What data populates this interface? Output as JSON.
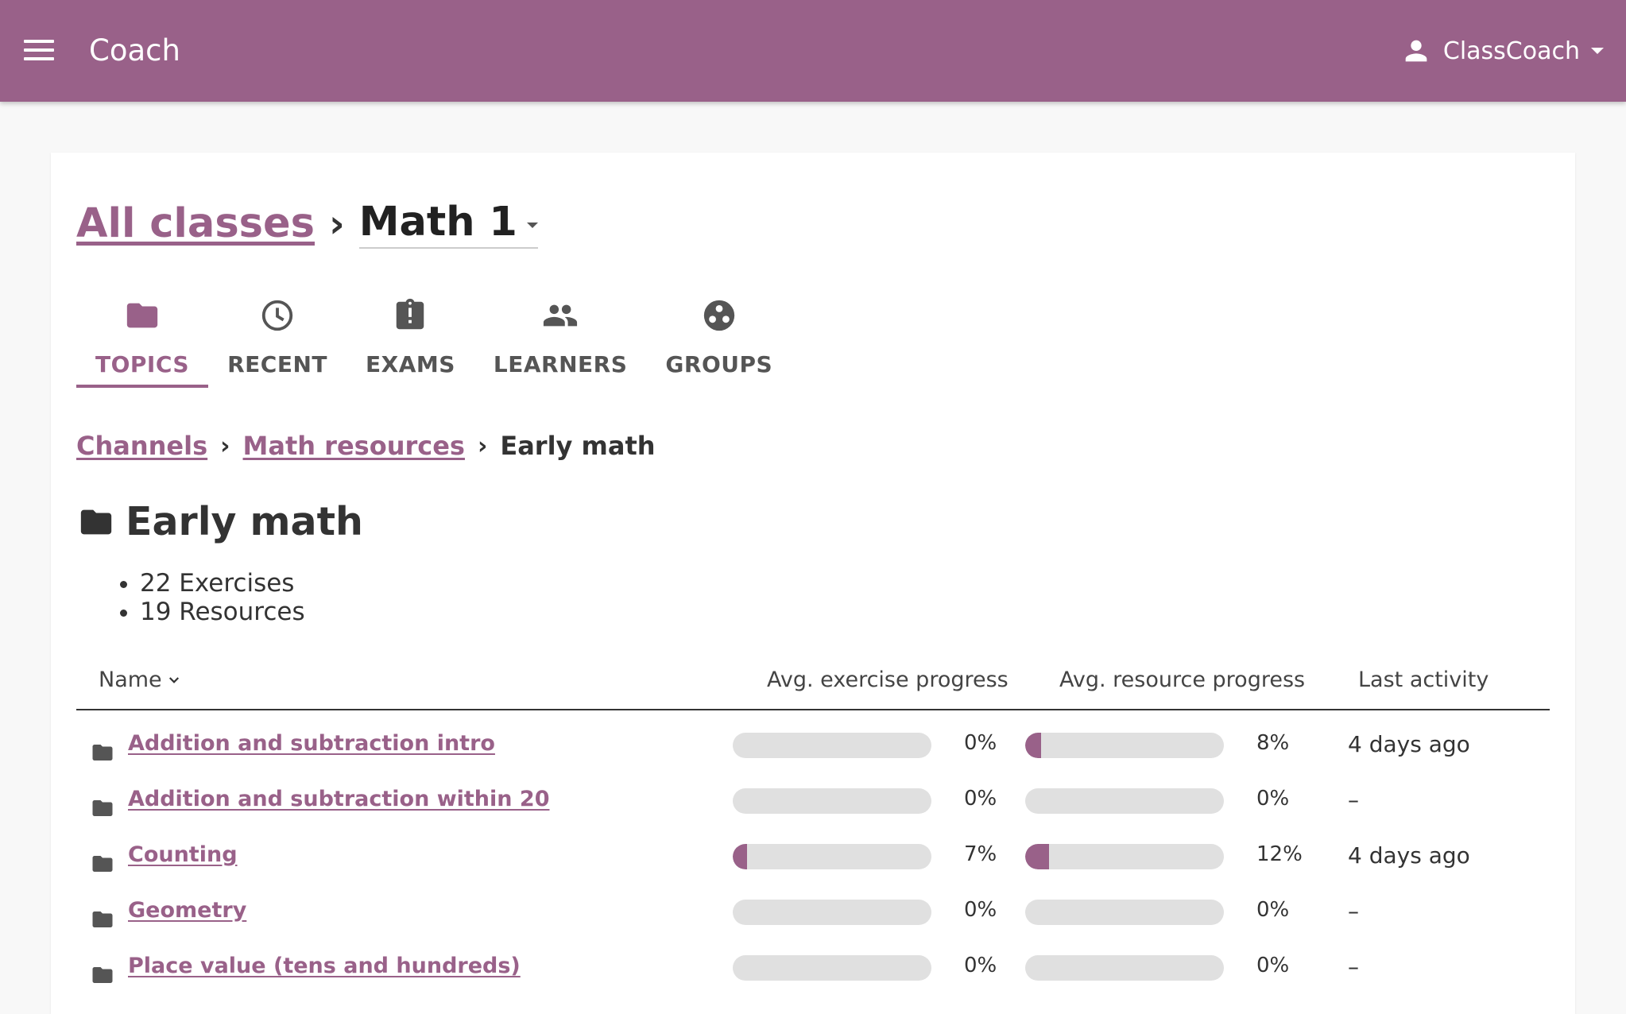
{
  "appbar": {
    "title": "Coach",
    "user_name": "ClassCoach",
    "color": "#996189"
  },
  "class_header": {
    "all_classes_label": "All classes",
    "separator": "›",
    "class_name": "Math 1"
  },
  "tabs": [
    {
      "label": "TOPICS",
      "icon": "folder-icon",
      "active": true
    },
    {
      "label": "RECENT",
      "icon": "clock-icon",
      "active": false
    },
    {
      "label": "EXAMS",
      "icon": "exam-clipboard-icon",
      "active": false
    },
    {
      "label": "LEARNERS",
      "icon": "people-icon",
      "active": false
    },
    {
      "label": "GROUPS",
      "icon": "groups-icon",
      "active": false
    }
  ],
  "breadcrumbs": {
    "items": [
      "Channels",
      "Math resources"
    ],
    "current": "Early math",
    "separator": "›"
  },
  "topic": {
    "title": "Early math",
    "counts": [
      "22 Exercises",
      "19 Resources"
    ]
  },
  "table": {
    "headers": {
      "name": "Name",
      "exercise_progress": "Avg. exercise progress",
      "resource_progress": "Avg. resource progress",
      "last_activity": "Last activity"
    },
    "rows": [
      {
        "name": "Addition and subtraction intro",
        "exercise_pct": 0,
        "exercise_label": "0%",
        "resource_pct": 8,
        "resource_label": "8%",
        "last_activity": "4 days ago"
      },
      {
        "name": "Addition and subtraction within 20",
        "exercise_pct": 0,
        "exercise_label": "0%",
        "resource_pct": 0,
        "resource_label": "0%",
        "last_activity": "–"
      },
      {
        "name": "Counting",
        "exercise_pct": 7,
        "exercise_label": "7%",
        "resource_pct": 12,
        "resource_label": "12%",
        "last_activity": "4 days ago"
      },
      {
        "name": "Geometry",
        "exercise_pct": 0,
        "exercise_label": "0%",
        "resource_pct": 0,
        "resource_label": "0%",
        "last_activity": "–"
      },
      {
        "name": "Place value (tens and hundreds)",
        "exercise_pct": 0,
        "exercise_label": "0%",
        "resource_pct": 0,
        "resource_label": "0%",
        "last_activity": "–"
      }
    ]
  }
}
